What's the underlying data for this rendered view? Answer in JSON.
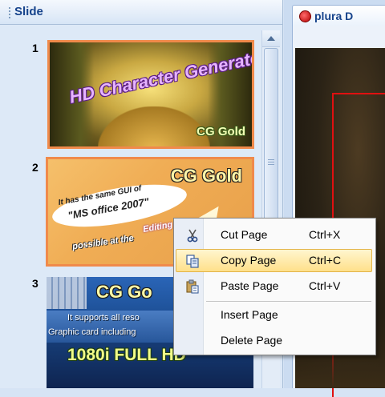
{
  "slide_panel": {
    "title": "Slide",
    "slides": [
      {
        "number": "1",
        "headline": "HD Character Generator",
        "brand": "CG Gold"
      },
      {
        "number": "2",
        "brand": "CG Gold",
        "line1": "It has the same GUI of",
        "line2": "\"MS office 2007\"",
        "line3": "Editing h",
        "line4": "possible at the"
      },
      {
        "number": "3",
        "brand": "CG Go",
        "line1": "It supports all reso",
        "line2": "Graphic card including",
        "line3": "1080i FULL HD"
      }
    ]
  },
  "document_tab": {
    "label": "plura D"
  },
  "context_menu": {
    "items": [
      {
        "label": "Cut Page",
        "shortcut": "Ctrl+X",
        "icon": "scissors-icon"
      },
      {
        "label": "Copy Page",
        "shortcut": "Ctrl+C",
        "icon": "copy-icon",
        "highlighted": true
      },
      {
        "label": "Paste Page",
        "shortcut": "Ctrl+V",
        "icon": "paste-icon"
      },
      {
        "label": "Insert Page",
        "shortcut": ""
      },
      {
        "label": "Delete Page",
        "shortcut": ""
      }
    ]
  },
  "colors": {
    "panel_bg": "#dde9f7",
    "header_text": "#15428b",
    "selection_outline": "#f08a4b",
    "menu_highlight": "#ffe08a"
  }
}
